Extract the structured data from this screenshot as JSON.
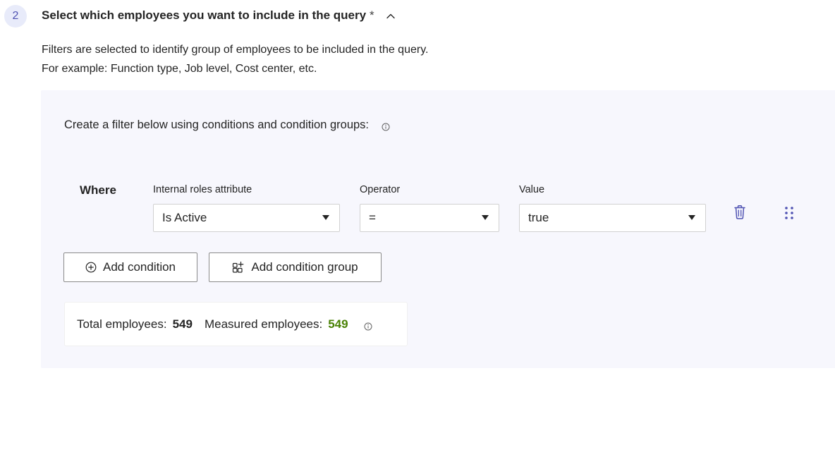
{
  "step": {
    "number": "2",
    "title": "Select which employees you want to include in the query",
    "required_marker": "*",
    "icon": "chevron-up-icon"
  },
  "description": {
    "line1": "Filters are selected to identify group of employees to be included in the query.",
    "line2": "For example: Function type, Job level, Cost center, etc."
  },
  "filter_panel": {
    "heading": "Create a filter below using conditions and condition groups:",
    "heading_icon": "info-icon",
    "condition": {
      "where_label": "Where",
      "attribute_label": "Internal roles attribute",
      "attribute_value": "Is Active",
      "operator_label": "Operator",
      "operator_value": "=",
      "value_label": "Value",
      "value_value": "true",
      "delete_icon": "trash-icon",
      "drag_icon": "drag-handle-icon"
    },
    "buttons": {
      "add_condition": "Add condition",
      "add_condition_icon": "add-circle-icon",
      "add_group": "Add condition group",
      "add_group_icon": "add-group-icon"
    },
    "stats": {
      "total_label": "Total employees:",
      "total_value": "549",
      "measured_label": "Measured employees:",
      "measured_value": "549",
      "info_icon": "info-icon"
    }
  },
  "colors": {
    "accent": "#4f52b2",
    "badge_bg": "#e8ebfa",
    "panel_bg": "#f7f7fd",
    "measured_green": "#498205"
  }
}
